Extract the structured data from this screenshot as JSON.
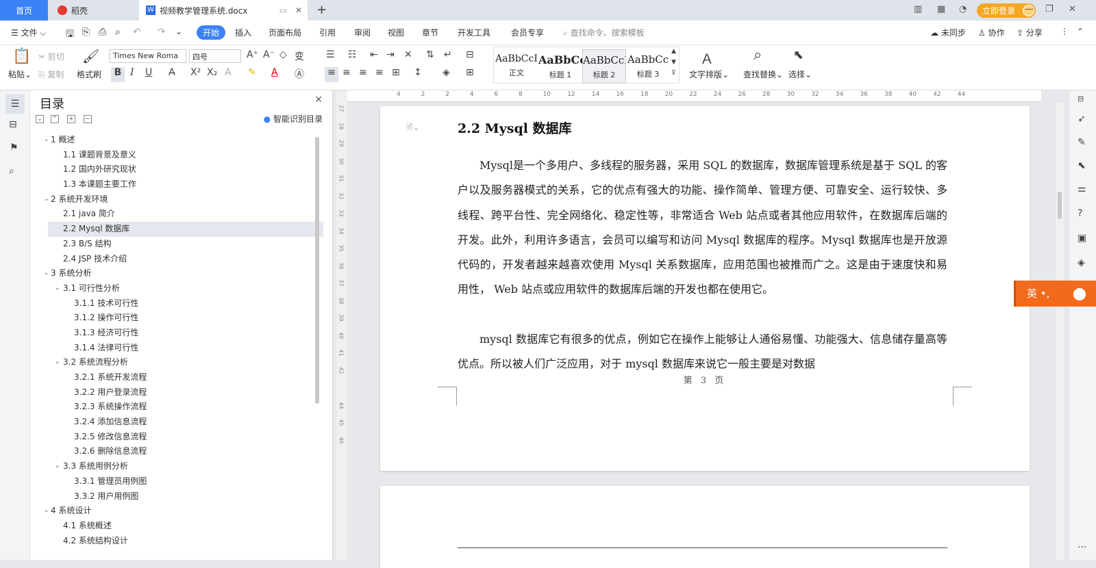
{
  "titlebar": {
    "home_tab": "首页",
    "daoke_tab": "稻壳",
    "doc_tab": "视频教学管理系统.docx",
    "login_button": "立即登录"
  },
  "menu": {
    "file": "文件",
    "items": [
      "开始",
      "插入",
      "页面布局",
      "引用",
      "审阅",
      "视图",
      "章节",
      "开发工具",
      "会员专享"
    ],
    "search_placeholder": "查找命令、搜索模板",
    "sync": "未同步",
    "collab": "协作",
    "share": "分享"
  },
  "ribbon": {
    "paste": "粘贴",
    "cut": "剪切",
    "copy": "复制",
    "format_painter": "格式刷",
    "font_name": "Times New Roma",
    "font_size": "四号",
    "styles": [
      {
        "preview": "AaBbCcI",
        "name": "正文"
      },
      {
        "preview": "AaBbCc",
        "name": "标题 1"
      },
      {
        "preview": "AaBbCcI",
        "name": "标题 2"
      },
      {
        "preview": "AaBbCc",
        "name": "标题 3"
      }
    ],
    "text_layout": "文字排版",
    "find_replace": "查找替换",
    "select": "选择"
  },
  "toc": {
    "title": "目录",
    "smart": "智能识别目录",
    "items": [
      {
        "text": "1  概述",
        "level": 1,
        "expanded": true
      },
      {
        "text": "1.1 课题背景及意义",
        "level": 2
      },
      {
        "text": "1.2  国内外研究现状",
        "level": 2
      },
      {
        "text": "1.3  本课题主要工作",
        "level": 2
      },
      {
        "text": "2  系统开发环境",
        "level": 1,
        "expanded": true
      },
      {
        "text": "2.1 java 简介",
        "level": 2
      },
      {
        "text": "2.2 Mysql 数据库",
        "level": 2,
        "selected": true
      },
      {
        "text": "2.3 B/S 结构",
        "level": 2
      },
      {
        "text": "2.4 JSP 技术介绍",
        "level": 2
      },
      {
        "text": "3  系统分析",
        "level": 1,
        "expanded": true
      },
      {
        "text": "3.1  可行性分析",
        "level": 2,
        "expanded": true
      },
      {
        "text": "3.1.1  技术可行性",
        "level": 3
      },
      {
        "text": "3.1.2 操作可行性",
        "level": 3
      },
      {
        "text": "3.1.3  经济可行性",
        "level": 3
      },
      {
        "text": "3.1.4  法律可行性",
        "level": 3
      },
      {
        "text": "3.2 系统流程分析",
        "level": 2,
        "expanded": true
      },
      {
        "text": "3.2.1 系统开发流程",
        "level": 3
      },
      {
        "text": "3.2.2  用户登录流程",
        "level": 3
      },
      {
        "text": "3.2.3  系统操作流程",
        "level": 3
      },
      {
        "text": "3.2.4  添加信息流程",
        "level": 3
      },
      {
        "text": "3.2.5  修改信息流程",
        "level": 3
      },
      {
        "text": "3.2.6  删除信息流程",
        "level": 3
      },
      {
        "text": "3.3 系统用例分析",
        "level": 2,
        "expanded": true
      },
      {
        "text": "3.3.1 管理员用例图",
        "level": 3
      },
      {
        "text": "3.3.2 用户用例图",
        "level": 3
      },
      {
        "text": "4  系统设计",
        "level": 1,
        "expanded": true
      },
      {
        "text": "4.1  系统概述",
        "level": 2
      },
      {
        "text": "4.2  系统结构设计",
        "level": 2
      }
    ]
  },
  "document": {
    "heading": "2.2 Mysql 数据库",
    "paragraph1": "Mysql是一个多用户、多线程的服务器，采用 SQL 的数据库，数据库管理系统是基于 SQL 的客户以及服务器模式的关系，它的优点有强大的功能、操作简单、管理方便、可靠安全、运行较快、多线程、跨平台性、完全网络化、稳定性等，非常适合 Web 站点或者其他应用软件，在数据库后端的开发。此外，利用许多语言，会员可以编写和访问 Mysql 数据库的程序。Mysql 数据库也是开放源代码的，开发者越来越喜欢使用 Mysql 关系数据库，应用范围也被推而广之。这是由于速度快和易用性， Web 站点或应用软件的数据库后端的开发也都在使用它。",
    "paragraph2": "mysql 数据库它有很多的优点，例如它在操作上能够让人通俗易懂、功能强大、信息储存量高等优点。所以被人们广泛应用，对于 mysql 数据库来说它一般主要是对数据",
    "page_label": "第 3 页"
  },
  "ruler": {
    "h_ticks": [
      "4",
      "2",
      "2",
      "4",
      "6",
      "8",
      "10",
      "12",
      "14",
      "16",
      "18",
      "20",
      "22",
      "24",
      "26",
      "28",
      "30",
      "32",
      "34",
      "36",
      "38",
      "40",
      "42",
      "44"
    ],
    "v_ticks": [
      "27",
      "28",
      "29",
      "30",
      "31",
      "32",
      "33",
      "34",
      "35",
      "36",
      "37",
      "38",
      "39",
      "40",
      "41",
      "42",
      "44",
      "45",
      "46"
    ]
  },
  "ime": {
    "label": "英 •,"
  }
}
